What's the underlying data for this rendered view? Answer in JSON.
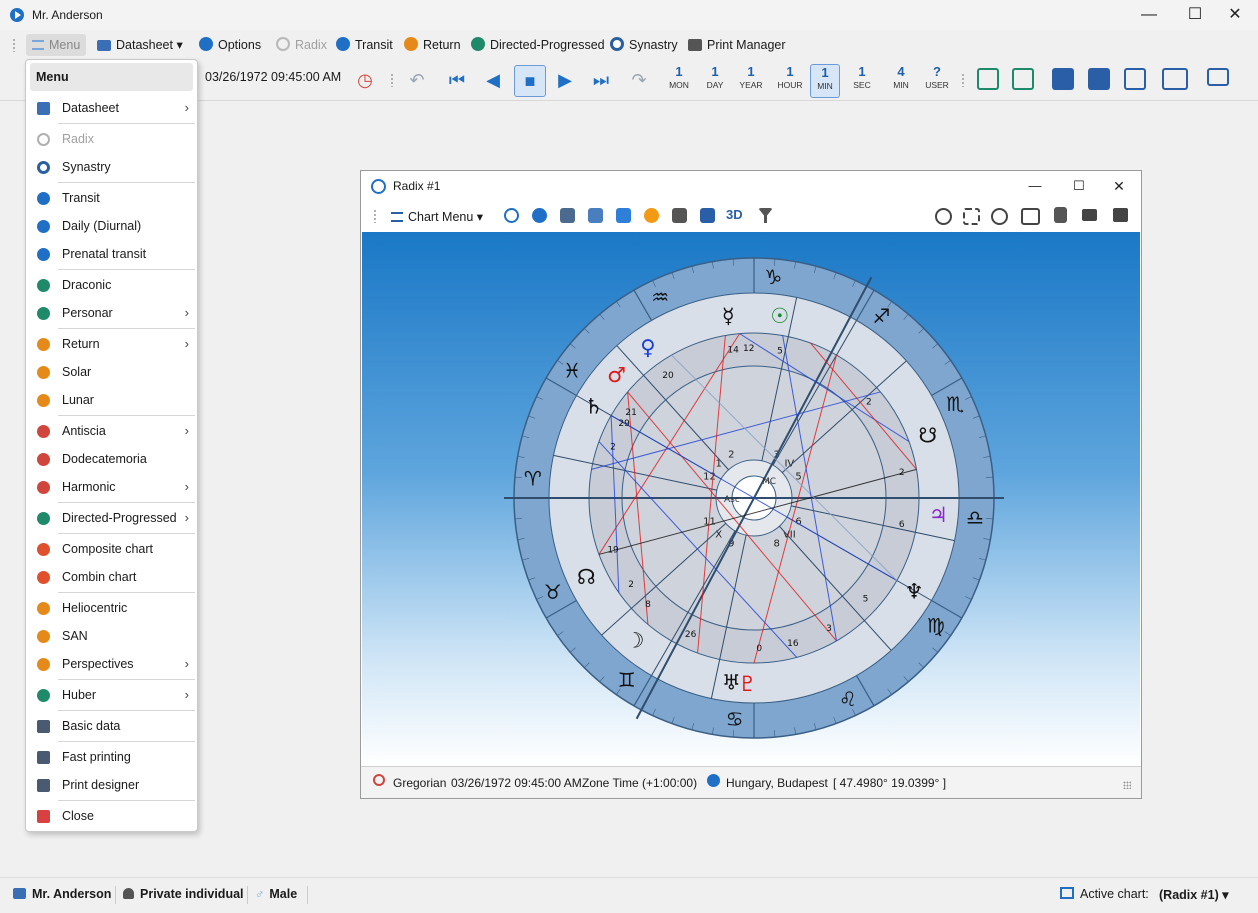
{
  "window": {
    "title": "Mr. Anderson",
    "controls": {
      "minimize": "—",
      "maximize": "☐",
      "close": "✕"
    }
  },
  "toolbar": {
    "menu_label": "Menu",
    "datasheet_label": "Datasheet",
    "options_label": "Options",
    "radix_label": "Radix",
    "transit_label": "Transit",
    "return_label": "Return",
    "directed_label": "Directed-Progressed",
    "synastry_label": "Synastry",
    "print_manager_label": "Print Manager"
  },
  "timebar": {
    "datetime": "03/26/1972 09:45:00 AM",
    "steps": [
      {
        "num": "1",
        "label": "MON"
      },
      {
        "num": "1",
        "label": "DAY"
      },
      {
        "num": "1",
        "label": "YEAR"
      },
      {
        "num": "1",
        "label": "HOUR"
      },
      {
        "num": "1",
        "label": "MIN"
      },
      {
        "num": "1",
        "label": "SEC"
      },
      {
        "num": "4",
        "label": "MIN"
      },
      {
        "num": "?",
        "label": "USER"
      }
    ],
    "active_step": "MIN"
  },
  "menu": {
    "header": "Menu",
    "items": [
      {
        "label": "Datasheet",
        "submenu": true,
        "color": "#3a6fb5"
      },
      {
        "label": "Radix",
        "disabled": true,
        "color": "#b0b0b0"
      },
      {
        "label": "Synastry",
        "color": "#2a5fa0"
      },
      {
        "label": "Transit",
        "color": "#1f6fc6"
      },
      {
        "label": "Daily (Diurnal)",
        "color": "#1f6fc6"
      },
      {
        "label": "Prenatal transit",
        "color": "#1f6fc6"
      },
      {
        "label": "Draconic",
        "color": "#1e8a6a"
      },
      {
        "label": "Personar",
        "submenu": true,
        "color": "#1e8a6a"
      },
      {
        "label": "Return",
        "submenu": true,
        "color": "#e58a18"
      },
      {
        "label": "Solar",
        "color": "#e58a18"
      },
      {
        "label": "Lunar",
        "color": "#e58a18"
      },
      {
        "label": "Antiscia",
        "submenu": true,
        "color": "#d0453c"
      },
      {
        "label": "Dodecatemoria",
        "color": "#d0453c"
      },
      {
        "label": "Harmonic",
        "submenu": true,
        "color": "#d0453c"
      },
      {
        "label": "Directed-Progressed",
        "submenu": true,
        "color": "#1e8a6a"
      },
      {
        "label": "Composite chart",
        "color": "#e0502c"
      },
      {
        "label": "Combin chart",
        "color": "#e0502c"
      },
      {
        "label": "Heliocentric",
        "color": "#e58a18"
      },
      {
        "label": "SAN",
        "color": "#e58a18"
      },
      {
        "label": "Perspectives",
        "submenu": true,
        "color": "#e58a18"
      },
      {
        "label": "Huber",
        "submenu": true,
        "color": "#1e8a6a"
      },
      {
        "label": "Basic data",
        "color": "#4a5a70"
      },
      {
        "label": "Fast printing",
        "color": "#4a5a70"
      },
      {
        "label": "Print designer",
        "color": "#4a5a70"
      },
      {
        "label": "Close",
        "color": "#d94040"
      }
    ]
  },
  "chart_window": {
    "title": "Radix #1",
    "chart_menu_label": "Chart Menu",
    "status": {
      "calendar": "Gregorian",
      "datetime": "03/26/1972 09:45:00 AM",
      "zone": "Zone Time (+1:00:00)",
      "place": "Hungary, Budapest",
      "coords": "[ 47.4980°  19.0399° ]"
    }
  },
  "chart_wheel": {
    "signs": [
      "♈",
      "♉",
      "♊",
      "♋",
      "♌",
      "♍",
      "♎",
      "♏",
      "♐",
      "♑",
      "♒",
      "♓"
    ],
    "houses": [
      "12",
      "1",
      "2",
      "3",
      "IV",
      "5",
      "6",
      "VII",
      "8",
      "9",
      "X",
      "11"
    ],
    "axis_labels": {
      "asc": "Asc",
      "mc": "MC"
    },
    "planets": [
      {
        "glyph": "☉",
        "color": "#1a8a2a"
      },
      {
        "glyph": "♀",
        "color": "#1a3fd8"
      },
      {
        "glyph": "♂",
        "color": "#e01818"
      },
      {
        "glyph": "♃",
        "color": "#8a2ac8"
      },
      {
        "glyph": "♄",
        "color": "#111111"
      },
      {
        "glyph": "♅",
        "color": "#111111"
      },
      {
        "glyph": "♆",
        "color": "#111111"
      },
      {
        "glyph": "♇",
        "color": "#e01818"
      },
      {
        "glyph": "☽",
        "color": "#111111"
      },
      {
        "glyph": "☿",
        "color": "#111111"
      },
      {
        "glyph": "☊",
        "color": "#111111"
      },
      {
        "glyph": "☋",
        "color": "#111111"
      }
    ],
    "degree_labels": [
      "14",
      "12",
      "5",
      "21",
      "29",
      "2",
      "20",
      "2",
      "2",
      "6",
      "19",
      "2",
      "8",
      "26",
      "0",
      "16",
      "3",
      "5"
    ]
  },
  "statusbar": {
    "user": "Mr. Anderson",
    "type": "Private individual",
    "sex": "Male",
    "active_chart_label": "Active chart:",
    "active_chart_value": "(Radix #1)"
  }
}
